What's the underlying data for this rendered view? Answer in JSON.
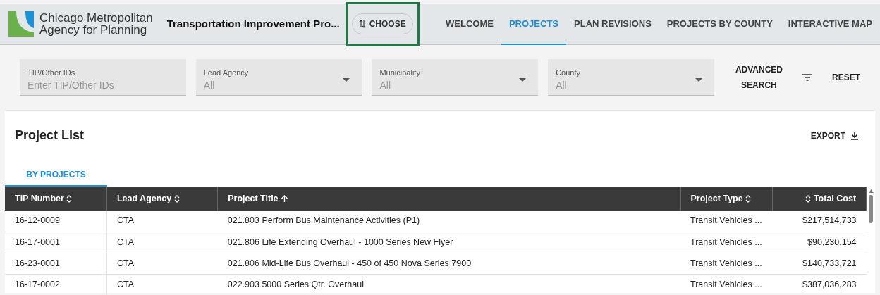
{
  "header": {
    "logo_text": [
      "Chicago Metropolitan",
      "Agency for Planning"
    ],
    "app_title": "Transportation Improvement Pro...",
    "choose_button": "CHOOSE",
    "choose_highlighted": true,
    "nav": [
      {
        "label": "WELCOME",
        "selected": false
      },
      {
        "label": "PROJECTS",
        "selected": true
      },
      {
        "label": "PLAN REVISIONS",
        "selected": false
      },
      {
        "label": "PROJECTS BY COUNTY",
        "selected": false
      },
      {
        "label": "INTERACTIVE MAP",
        "selected": false
      }
    ]
  },
  "filters": [
    {
      "kind": "text",
      "label": "TIP/Other IDs",
      "placeholder": "Enter TIP/Other IDs"
    },
    {
      "kind": "select",
      "label": "Lead Agency",
      "value": "All"
    },
    {
      "kind": "select",
      "label": "Municipality",
      "value": "All"
    },
    {
      "kind": "select",
      "label": "County",
      "value": "All"
    }
  ],
  "advanced_search": [
    "ADVANCED",
    "SEARCH"
  ],
  "reset": "RESET",
  "project_list": {
    "title": "Project List",
    "export": "EXPORT",
    "tabs": [
      {
        "label": "BY PROJECTS",
        "selected": true
      }
    ],
    "table": {
      "columns": [
        {
          "label": "TIP Number",
          "kind": "text",
          "sorted": false
        },
        {
          "label": "Lead Agency",
          "kind": "text",
          "sorted": false
        },
        {
          "label": "Project Title",
          "kind": "text",
          "sorted": true
        },
        {
          "label": "Project Type",
          "kind": "text",
          "sorted": false
        },
        {
          "label": "Total Cost",
          "kind": "money",
          "sorted": false
        }
      ],
      "rows": [
        [
          "16-12-0009",
          "CTA",
          "021.803 Perform Bus Maintenance Activities (P1)",
          "Transit Vehicles ...",
          "$217,514,733"
        ],
        [
          "16-17-0001",
          "CTA",
          "021.806 Life Extending Overhaul - 1000 Series New Flyer",
          "Transit Vehicles ...",
          "$90,230,154"
        ],
        [
          "16-23-0001",
          "CTA",
          "021.806 Mid-Life Bus Overhaul - 450 of 450 Nova Series 7900",
          "Transit Vehicles ...",
          "$140,733,721"
        ],
        [
          "16-17-0002",
          "CTA",
          "022.903 5000 Series Qtr. Overhaul",
          "Transit Vehicles ...",
          "$387,036,283"
        ]
      ]
    }
  }
}
